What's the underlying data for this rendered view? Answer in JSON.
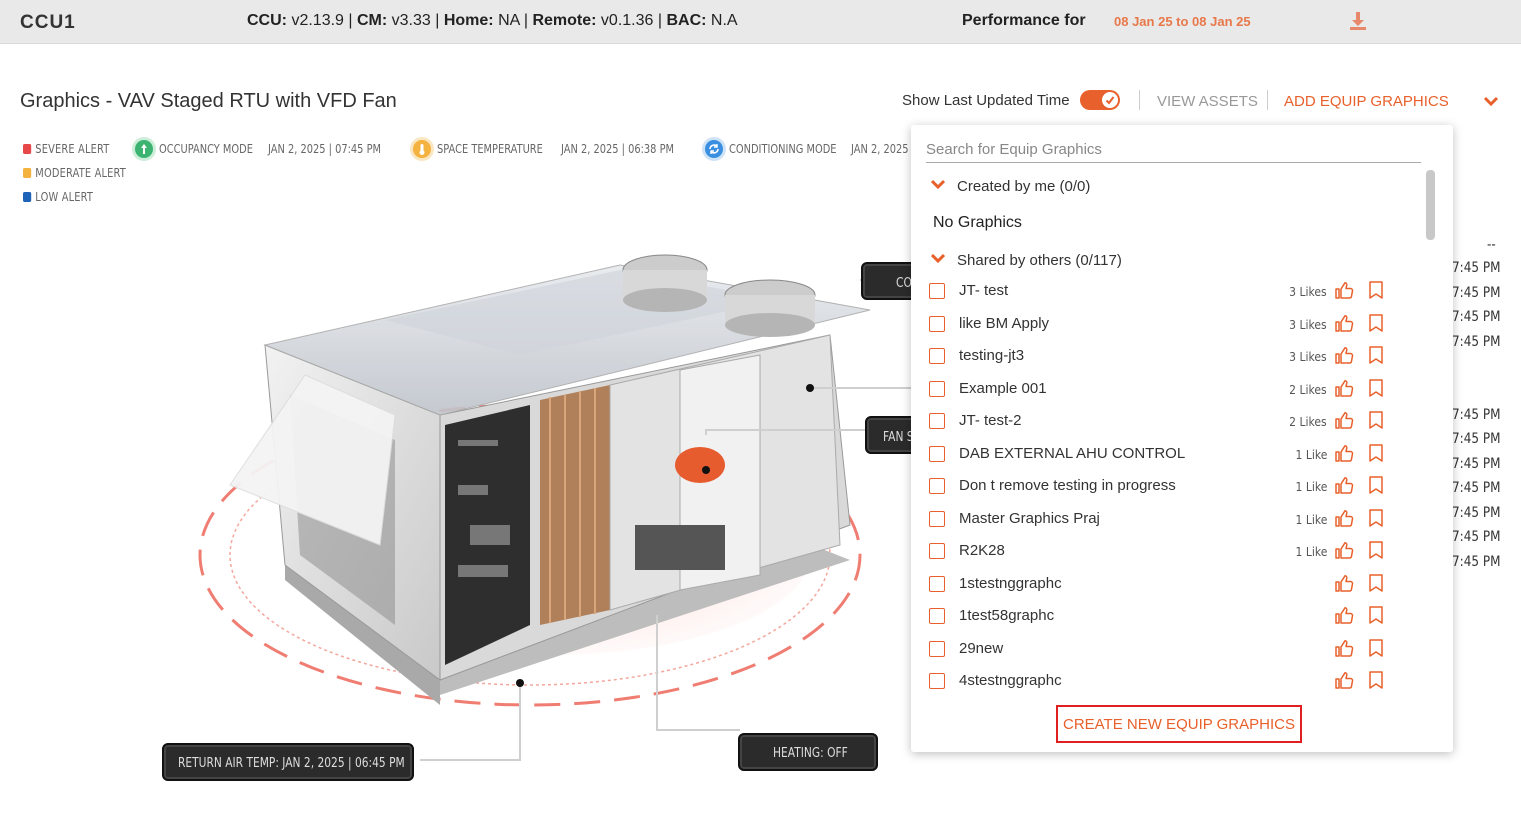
{
  "header": {
    "ccu_name": "CCU1",
    "versions": [
      {
        "label": "CCU:",
        "value": " v2.13.9"
      },
      {
        "label": "CM:",
        "value": " v3.33"
      },
      {
        "label": "Home:",
        "value": " NA"
      },
      {
        "label": "Remote:",
        "value": " v0.1.36"
      },
      {
        "label": "BAC:",
        "value": " N.A"
      }
    ],
    "separator": " | ",
    "performance_label": "Performance for",
    "performance_range": "08 Jan 25 to 08 Jan 25",
    "download_icon": "download-icon"
  },
  "page": {
    "title": "Graphics - VAV Staged RTU with VFD Fan",
    "show_last_updated_label": "Show Last Updated Time",
    "show_last_updated_on": true,
    "view_assets": "VIEW ASSETS",
    "add_equip_graphics": "ADD EQUIP GRAPHICS"
  },
  "legend": [
    {
      "label": "SEVERE ALERT",
      "color": "#e8474a"
    },
    {
      "label": "MODERATE ALERT",
      "color": "#f4b23e"
    },
    {
      "label": "LOW ALERT",
      "color": "#1e63b8"
    }
  ],
  "status_items": [
    {
      "label": "OCCUPANCY MODE",
      "date": "JAN 2, 2025 | 07:45 PM",
      "color": "#3cb371",
      "icon": "occupancy-icon"
    },
    {
      "label": "SPACE TEMPERATURE",
      "date": "JAN 2, 2025 | 06:38 PM",
      "color": "#f4b23e",
      "icon": "temperature-icon"
    },
    {
      "label": "CONDITIONING MODE",
      "date": "JAN 2, 2025",
      "color": "#3a8fe0",
      "icon": "conditioning-icon"
    }
  ],
  "tags": {
    "top": "CO",
    "fan": "FAN S",
    "return_air": "RETURN AIR TEMP: JAN 2, 2025 | 06:45 PM",
    "heating": "HEATING: OFF"
  },
  "right_times": [
    "--",
    "7:45 PM",
    "7:45 PM",
    "7:45 PM",
    "7:45 PM",
    "7:45 PM",
    "7:45 PM",
    "7:45 PM",
    "7:45 PM",
    "7:45 PM",
    "7:45 PM",
    "7:45 PM"
  ],
  "dropdown": {
    "search_placeholder": "Search for Equip Graphics",
    "created_by_me": "Created by me (0/0)",
    "no_graphics": "No Graphics",
    "shared_by_others": "Shared by others (0/117)",
    "items": [
      {
        "name": "JT- test",
        "likes": "3 Likes"
      },
      {
        "name": "like BM Apply",
        "likes": "3 Likes"
      },
      {
        "name": "testing-jt3",
        "likes": "3 Likes"
      },
      {
        "name": "Example 001",
        "likes": "2 Likes"
      },
      {
        "name": "JT- test-2",
        "likes": "2 Likes"
      },
      {
        "name": "DAB EXTERNAL AHU CONTROL",
        "likes": "1 Like"
      },
      {
        "name": "Don t remove testing in progress",
        "likes": "1 Like"
      },
      {
        "name": "Master Graphics Praj",
        "likes": "1 Like"
      },
      {
        "name": "R2K28",
        "likes": "1 Like"
      },
      {
        "name": "1stestnggraphc",
        "likes": ""
      },
      {
        "name": "1test58graphc",
        "likes": ""
      },
      {
        "name": "29new",
        "likes": ""
      },
      {
        "name": "4stestnggraphc",
        "likes": ""
      }
    ],
    "create_button": "CREATE NEW EQUIP GRAPHICS"
  },
  "colors": {
    "accent": "#e8602b",
    "header_bg": "#e9e9e9",
    "create_border": "#e02020"
  }
}
